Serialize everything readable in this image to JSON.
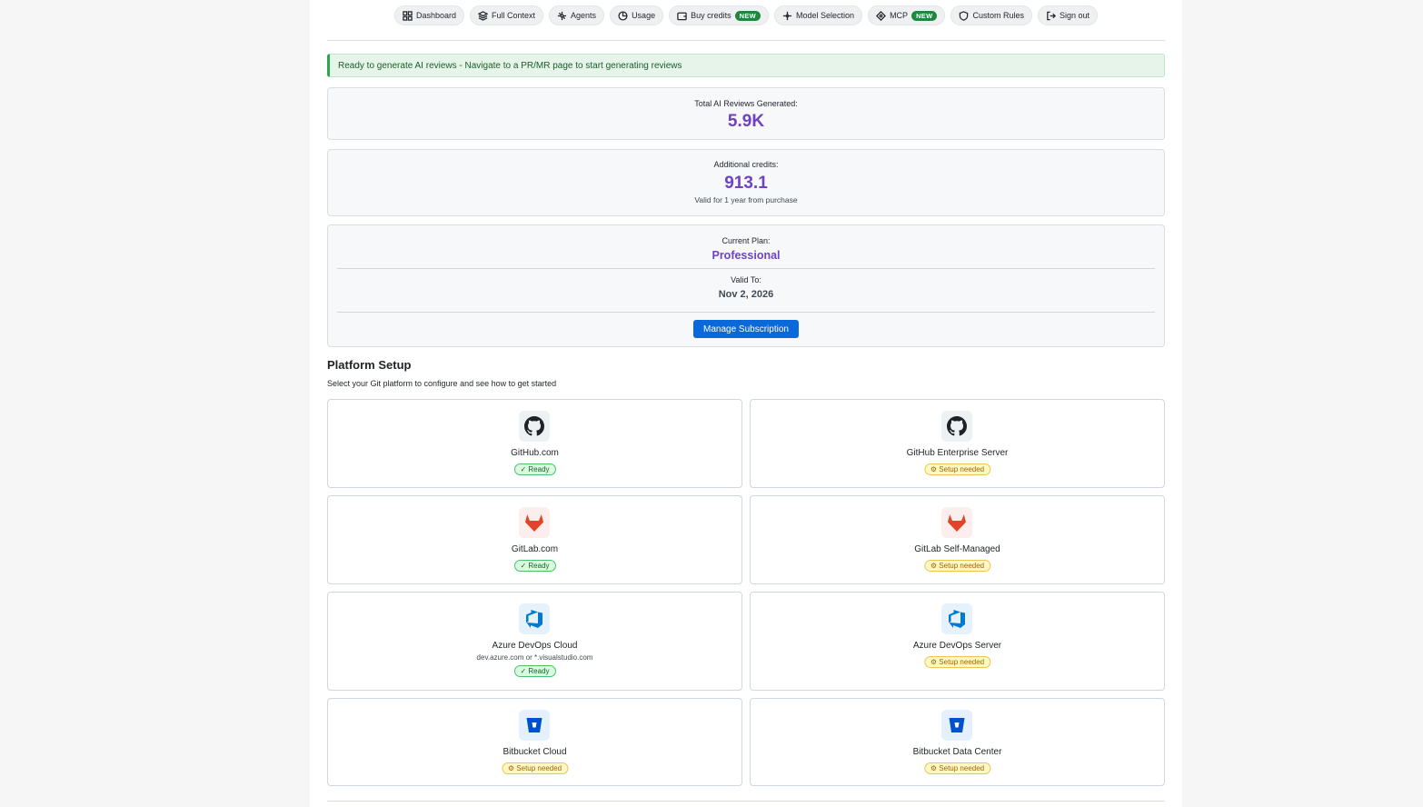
{
  "nav": {
    "items": [
      {
        "label": "Dashboard",
        "icon": "grid-icon"
      },
      {
        "label": "Full Context",
        "icon": "layers-icon"
      },
      {
        "label": "Agents",
        "icon": "agents-icon"
      },
      {
        "label": "Usage",
        "icon": "pie-chart-icon"
      },
      {
        "label": "Buy credits",
        "icon": "wallet-icon",
        "badge": "NEW"
      },
      {
        "label": "Model Selection",
        "icon": "sparkle-icon"
      },
      {
        "label": "MCP",
        "icon": "connector-icon",
        "badge": "NEW"
      },
      {
        "label": "Custom Rules",
        "icon": "shield-icon"
      },
      {
        "label": "Sign out",
        "icon": "sign-out-icon"
      }
    ]
  },
  "alert": {
    "text": "Ready to generate AI reviews - Navigate to a PR/MR page to start generating reviews"
  },
  "stats": {
    "reviews_label": "Total AI Reviews Generated:",
    "reviews_value": "5.9K",
    "credits_label": "Additional credits:",
    "credits_value": "913.1",
    "credits_note": "Valid for 1 year from purchase"
  },
  "plan": {
    "label": "Current Plan:",
    "name": "Professional",
    "valid_label": "Valid To:",
    "valid_date": "Nov 2, 2026",
    "manage_label": "Manage Subscription"
  },
  "platform": {
    "title": "Platform Setup",
    "subtitle": "Select your Git platform to configure and see how to get started",
    "items": [
      {
        "name": "GitHub.com",
        "desc": "",
        "status": "✓ Ready",
        "state": "ready",
        "icon": "github-icon"
      },
      {
        "name": "GitHub Enterprise Server",
        "desc": "",
        "status": "⚙ Setup needed",
        "state": "setup",
        "icon": "github-icon"
      },
      {
        "name": "GitLab.com",
        "desc": "",
        "status": "✓ Ready",
        "state": "ready",
        "icon": "gitlab-icon"
      },
      {
        "name": "GitLab Self-Managed",
        "desc": "",
        "status": "⚙ Setup needed",
        "state": "setup",
        "icon": "gitlab-icon"
      },
      {
        "name": "Azure DevOps Cloud",
        "desc": "dev.azure.com or *.visualstudio.com",
        "status": "✓ Ready",
        "state": "ready",
        "icon": "azure-devops-icon"
      },
      {
        "name": "Azure DevOps Server",
        "desc": "",
        "status": "⚙ Setup needed",
        "state": "setup",
        "icon": "azure-devops-icon"
      },
      {
        "name": "Bitbucket Cloud",
        "desc": "",
        "status": "⚙ Setup needed",
        "state": "setup",
        "icon": "bitbucket-icon"
      },
      {
        "name": "Bitbucket Data Center",
        "desc": "",
        "status": "⚙ Setup needed",
        "state": "setup",
        "icon": "bitbucket-icon"
      }
    ]
  },
  "colors": {
    "accent": "#6f42c1",
    "primary": "#0969da",
    "ready": "#1f883d",
    "setup": "#bf8700"
  }
}
